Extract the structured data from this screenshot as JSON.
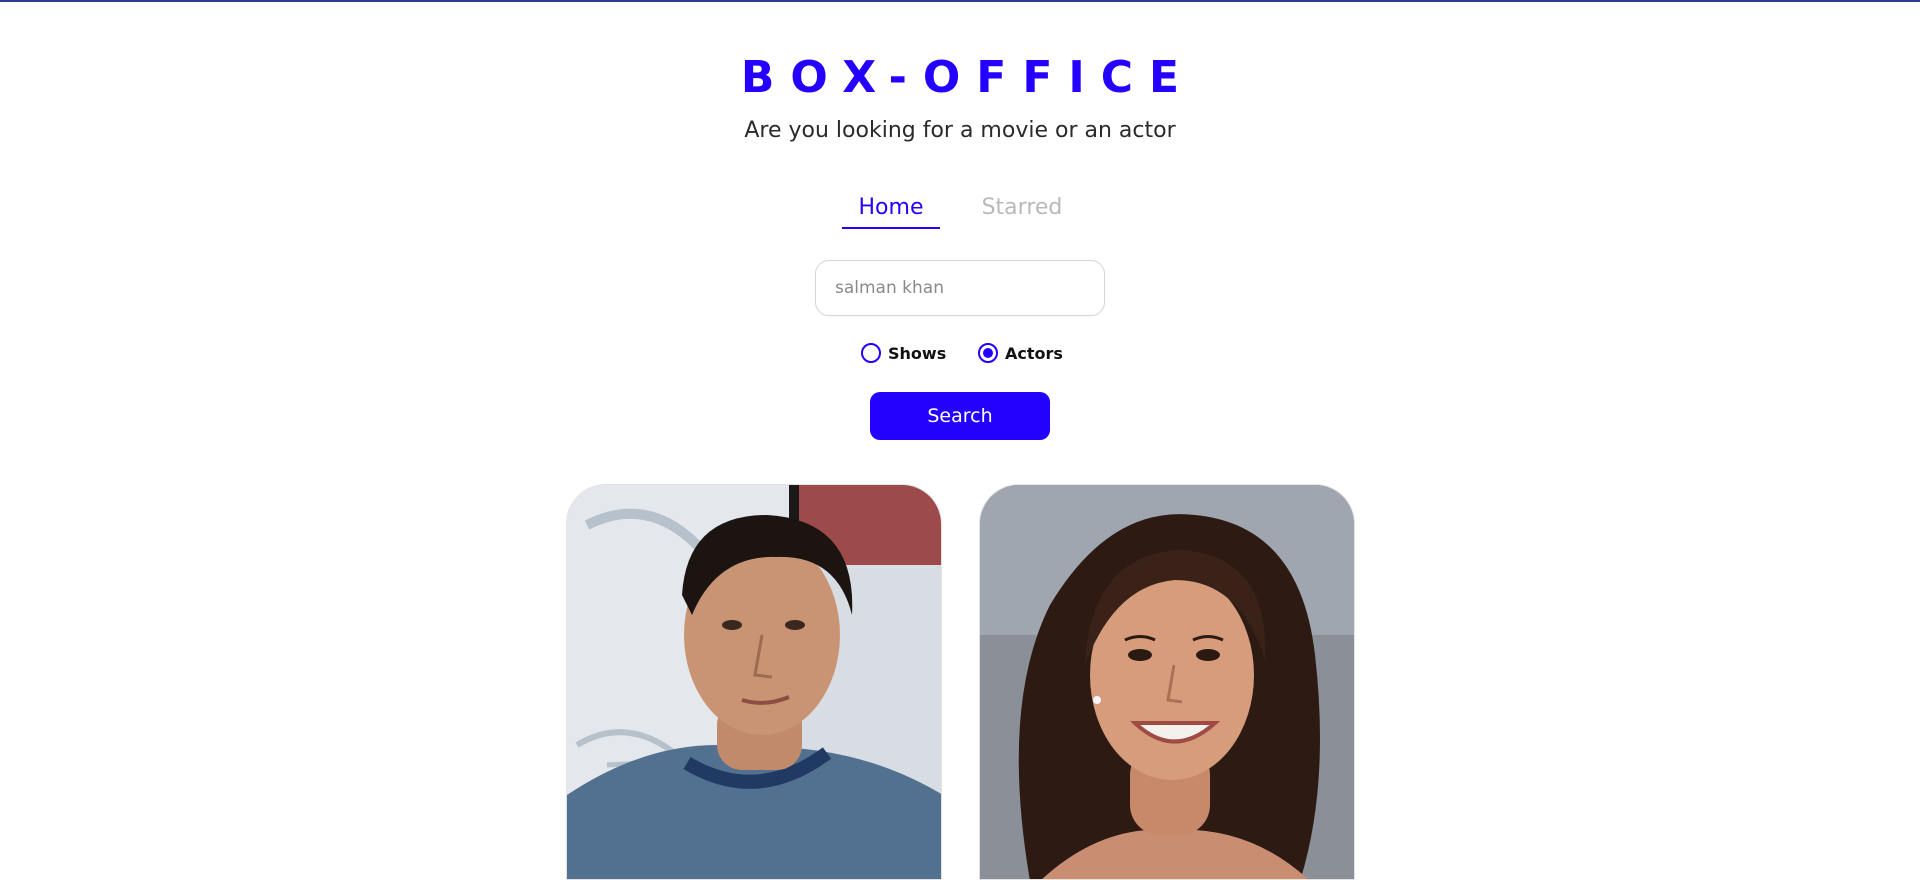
{
  "app": {
    "title": "BOX-OFFICE",
    "subtitle": "Are you looking for a movie or an actor"
  },
  "nav": {
    "items": [
      {
        "label": "Home",
        "active": true
      },
      {
        "label": "Starred",
        "active": false
      }
    ]
  },
  "search": {
    "value": "",
    "placeholder": "salman khan",
    "button_label": "Search"
  },
  "search_type": {
    "options": [
      {
        "label": "Shows",
        "selected": false
      },
      {
        "label": "Actors",
        "selected": true
      }
    ]
  },
  "results": [
    {
      "image_icon": "actor-photo-icon"
    },
    {
      "image_icon": "actor-photo-icon"
    }
  ],
  "colors": {
    "accent": "#2400ff",
    "inactive_nav": "#b9b9b9"
  }
}
